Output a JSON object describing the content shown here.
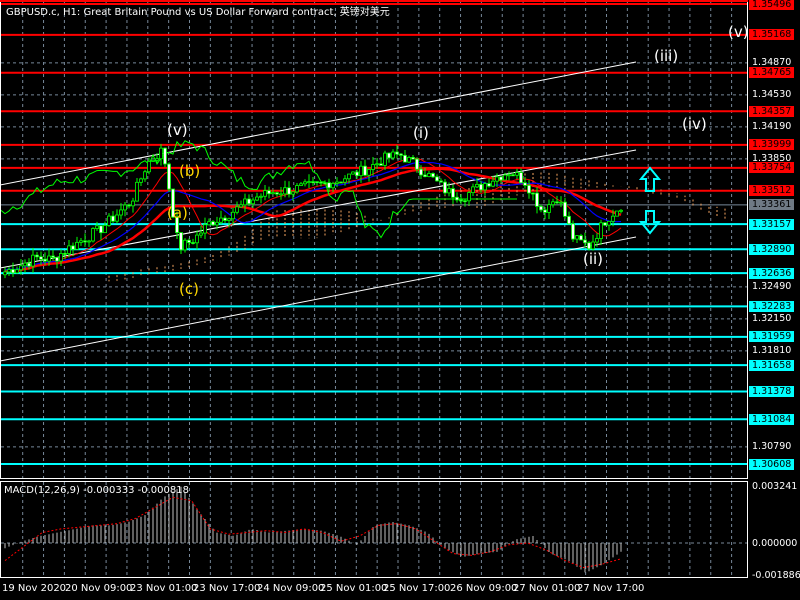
{
  "header": {
    "title": "GBPUSD.c, H1:  Great Britain Pound vs US Dollar Forward contract, 英镑对美元"
  },
  "colors": {
    "bg": "#000000",
    "resistance": "#ff0000",
    "support": "#00ffff",
    "bull": "#00ff00",
    "trend": "#ffffff",
    "cloud": "#f4a460",
    "wave_a_b_c": "#ffd700"
  },
  "price_axis": {
    "range": [
      1.30608,
      1.35496
    ],
    "ticks": [
      "1.34870",
      "1.34530",
      "1.34190",
      "1.33850",
      "1.32490",
      "1.32150",
      "1.31810",
      "1.30790"
    ],
    "resistance_levels": [
      "1.35496",
      "1.35168",
      "1.34765",
      "1.34357",
      "1.33999",
      "1.33754",
      "1.33512"
    ],
    "support_levels": [
      "1.33157",
      "1.32890",
      "1.32636",
      "1.32283",
      "1.31959",
      "1.31658",
      "1.31378",
      "1.31084",
      "1.30608"
    ],
    "current_price": "1.33361"
  },
  "time_axis": [
    "19 Nov 2020",
    "20 Nov 09:00",
    "23 Nov 01:00",
    "23 Nov 17:00",
    "24 Nov 09:00",
    "25 Nov 01:00",
    "25 Nov 17:00",
    "26 Nov 09:00",
    "27 Nov 01:00",
    "27 Nov 17:00"
  ],
  "wave_labels": [
    {
      "text": "(v)",
      "color": "#ffffff"
    },
    {
      "text": "(b)",
      "color": "#ffd700"
    },
    {
      "text": "(a)",
      "color": "#ffd700"
    },
    {
      "text": "(c)",
      "color": "#ffd700"
    },
    {
      "text": "(i)",
      "color": "#ffffff"
    },
    {
      "text": "(ii)",
      "color": "#ffffff"
    },
    {
      "text": "(iii)",
      "color": "#ffffff"
    },
    {
      "text": "(iv)",
      "color": "#ffffff"
    },
    {
      "text": "(v)",
      "color": "#ffffff"
    }
  ],
  "macd": {
    "label": "MACD(12,26,9) -0.000333 -0.000818",
    "max": "0.003241",
    "zero": "0.000000",
    "min": "-0.001886"
  },
  "chart_data": {
    "type": "candlestick",
    "symbol": "GBPUSD.c",
    "timeframe": "H1",
    "close_anchors": [
      1.3265,
      1.3272,
      1.328,
      1.3278,
      1.329,
      1.33,
      1.331,
      1.3325,
      1.334,
      1.338,
      1.3395,
      1.329,
      1.33,
      1.3318,
      1.3325,
      1.3335,
      1.3345,
      1.335,
      1.3352,
      1.3355,
      1.3358,
      1.3362,
      1.3368,
      1.3375,
      1.3385,
      1.339,
      1.3378,
      1.3365,
      1.335,
      1.3345,
      1.3355,
      1.3365,
      1.3372,
      1.336,
      1.333,
      1.3345,
      1.33,
      1.3292,
      1.332,
      1.3336
    ],
    "macd_hist": [
      -0.0003,
      0.0001,
      0.0004,
      0.0006,
      0.0008,
      0.001,
      0.001,
      0.0012,
      0.0016,
      0.0026,
      0.0032,
      0.0018,
      0.0006,
      0.0004,
      0.0008,
      0.0006,
      0.0007,
      0.0008,
      0.0007,
      0.0004,
      -0.0001,
      0.001,
      0.0012,
      0.001,
      0.0006,
      -0.0003,
      -0.0008,
      -0.0006,
      -0.0005,
      0.0002,
      0.0004,
      -0.0006,
      -0.001,
      -0.0017,
      -0.0012,
      -0.0005
    ],
    "macd_signal": [
      -0.001,
      -0.0002,
      0.0006,
      0.0008,
      0.0009,
      0.001,
      0.0011,
      0.0014,
      0.002,
      0.0026,
      0.0024,
      0.0008,
      0.0005,
      0.0006,
      0.0007,
      0.0006,
      0.0008,
      0.0006,
      0.0001,
      0.0004,
      0.001,
      0.0011,
      0.0008,
      0.0001,
      -0.0006,
      -0.0007,
      -0.0005,
      -0.0001,
      0.0,
      -0.0004,
      -0.001,
      -0.0014,
      -0.0012,
      -0.0009
    ]
  }
}
